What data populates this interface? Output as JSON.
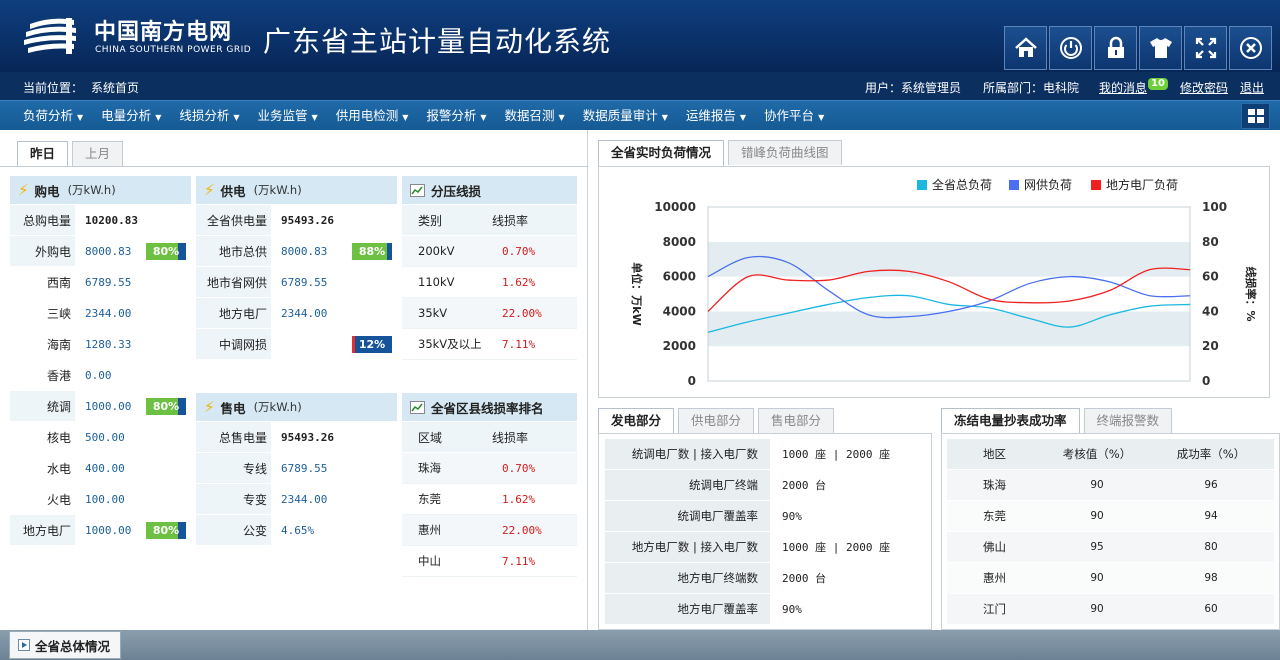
{
  "header": {
    "brand_cn": "中国南方电网",
    "brand_en": "CHINA SOUTHERN POWER GRID",
    "system_title": "广东省主站计量自动化系统",
    "buttons": [
      {
        "name": "home-icon"
      },
      {
        "name": "power-icon"
      },
      {
        "name": "lock-icon"
      },
      {
        "name": "shirt-icon"
      },
      {
        "name": "fullscreen-icon"
      },
      {
        "name": "close-icon"
      }
    ]
  },
  "crumb": {
    "label": "当前位置：",
    "page": "系统首页",
    "user_label": "用户：",
    "user": "系统管理员",
    "dept_label": "所属部门：",
    "dept": "电科院",
    "messages": "我的消息",
    "message_count": "10",
    "change_password": "修改密码",
    "logout": "退出"
  },
  "menu": [
    "负荷分析",
    "电量分析",
    "线损分析",
    "业务监管",
    "供用电检测",
    "报警分析",
    "数据召测",
    "数据质量审计",
    "运维报告",
    "协作平台"
  ],
  "left_tabs": [
    "昨日",
    "上月"
  ],
  "purchase": {
    "title": "购电",
    "unit": "(万kW.h)",
    "rows": [
      {
        "label": "总购电量",
        "value": "10200.83",
        "style": "dark",
        "indent": false
      },
      {
        "label": "外购电",
        "value": "8000.83",
        "bar": "80%",
        "pct": 0.8,
        "indent": false
      },
      {
        "label": "西南",
        "value": "6789.55",
        "indent": true
      },
      {
        "label": "三峡",
        "value": "2344.00",
        "indent": true
      },
      {
        "label": "海南",
        "value": "1280.33",
        "indent": true
      },
      {
        "label": "香港",
        "value": "0.00",
        "indent": true
      },
      {
        "label": "统调",
        "value": "1000.00",
        "bar": "80%",
        "pct": 0.8,
        "indent": false
      },
      {
        "label": "核电",
        "value": "500.00",
        "indent": true
      },
      {
        "label": "水电",
        "value": "400.00",
        "indent": true
      },
      {
        "label": "火电",
        "value": "100.00",
        "indent": true
      },
      {
        "label": "地方电厂",
        "value": "1000.00",
        "bar": "80%",
        "pct": 0.8,
        "indent": false
      }
    ]
  },
  "supply": {
    "title": "供电",
    "unit": "(万kW.h)",
    "rows": [
      {
        "label": "全省供电量",
        "value": "95493.26",
        "style": "dark"
      },
      {
        "label": "地市总供",
        "value": "8000.83",
        "bar": "88%",
        "pct": 0.88
      },
      {
        "label": "地市省网供",
        "value": "6789.55"
      },
      {
        "label": "地方电厂",
        "value": "2344.00"
      },
      {
        "label": "中调网损",
        "value": "",
        "bar": "12%",
        "pct": 0.12,
        "bar_color": "red"
      }
    ]
  },
  "sales": {
    "title": "售电",
    "unit": "(万kW.h)",
    "rows": [
      {
        "label": "总售电量",
        "value": "95493.26",
        "style": "dark"
      },
      {
        "label": "专线",
        "value": "6789.55"
      },
      {
        "label": "专变",
        "value": "2344.00"
      },
      {
        "label": "公变",
        "value": "4.65%"
      }
    ]
  },
  "voltage_loss": {
    "title": "分压线损",
    "col1": "类别",
    "col2": "线损率",
    "rows": [
      {
        "a": "200kV",
        "b": "0.70%"
      },
      {
        "a": "110kV",
        "b": "1.62%"
      },
      {
        "a": "35kV",
        "b": "22.00%"
      },
      {
        "a": "35kV及以上",
        "b": "7.11%"
      }
    ]
  },
  "county_rank": {
    "title": "全省区县线损率排名",
    "col1": "区域",
    "col2": "线损率",
    "rows": [
      {
        "a": "珠海",
        "b": "0.70%"
      },
      {
        "a": "东莞",
        "b": "1.62%"
      },
      {
        "a": "惠州",
        "b": "22.00%"
      },
      {
        "a": "中山",
        "b": "7.11%"
      }
    ]
  },
  "chart_tabs": [
    "全省实时负荷情况",
    "错峰负荷曲线图"
  ],
  "chart_data": {
    "type": "line",
    "ylabel": "单位：万kW",
    "y2label": "线损率：%",
    "ylim": [
      0,
      10000
    ],
    "y2lim": [
      0,
      100
    ],
    "yticks": [
      "0",
      "2000",
      "4000",
      "6000",
      "8000",
      "10000"
    ],
    "y2ticks": [
      "0",
      "20",
      "40",
      "60",
      "80",
      "100"
    ],
    "x": [
      0,
      1,
      2,
      3,
      4,
      5,
      6,
      7,
      8,
      9,
      10,
      11,
      12
    ],
    "series": [
      {
        "name": "全省总负荷",
        "color": "#1ab8e0",
        "values": [
          2800,
          3400,
          3900,
          4400,
          4800,
          4900,
          4400,
          4200,
          3600,
          3100,
          3800,
          4300,
          4400
        ]
      },
      {
        "name": "网供负荷",
        "color": "#4a6ff0",
        "values": [
          6000,
          7100,
          6800,
          5200,
          3800,
          3700,
          4000,
          4600,
          5600,
          6000,
          5700,
          4900,
          4900
        ]
      },
      {
        "name": "地方电厂负荷",
        "color": "#f02020",
        "values": [
          4000,
          6000,
          5800,
          5800,
          6300,
          6300,
          5700,
          4700,
          4500,
          4600,
          5200,
          6400,
          6400
        ]
      }
    ],
    "grid": true,
    "legend": "top"
  },
  "gen_tabs": [
    "发电部分",
    "供电部分",
    "售电部分"
  ],
  "gen_rows": [
    {
      "k": "统调电厂数 | 接入电厂数",
      "v": "1000 座 | 2000 座"
    },
    {
      "k": "统调电厂终端",
      "v": "2000 台"
    },
    {
      "k": "统调电厂覆盖率",
      "v": "90%"
    },
    {
      "k": "地方电厂数 | 接入电厂数",
      "v": "1000 座 | 2000 座"
    },
    {
      "k": "地方电厂终端数",
      "v": "2000 台"
    },
    {
      "k": "地方电厂覆盖率",
      "v": "90%"
    }
  ],
  "freeze_tabs": [
    "冻结电量抄表成功率",
    "终端报警数"
  ],
  "freeze": {
    "headers": [
      "地区",
      "考核值（%）",
      "成功率（%）"
    ],
    "rows": [
      [
        "珠海",
        "90",
        "96"
      ],
      [
        "东莞",
        "90",
        "94"
      ],
      [
        "佛山",
        "95",
        "80"
      ],
      [
        "惠州",
        "90",
        "98"
      ],
      [
        "江门",
        "90",
        "60"
      ]
    ]
  },
  "footer": {
    "label": "全省总体情况"
  }
}
